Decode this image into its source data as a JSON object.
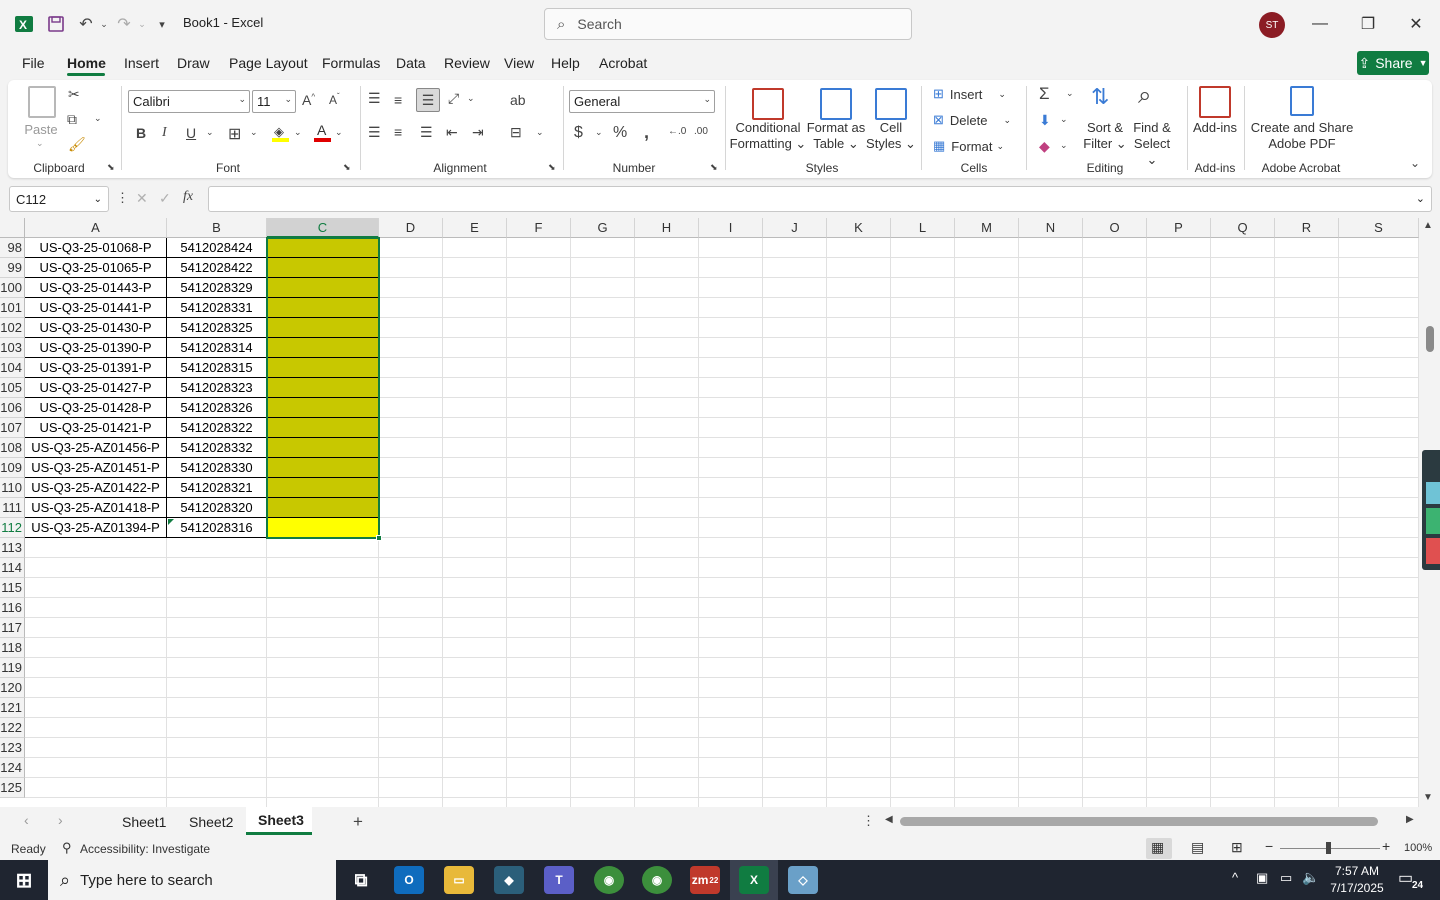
{
  "window": {
    "title": "Book1  -  Excel",
    "search_placeholder": "Search",
    "user_initials": "ST"
  },
  "menu": {
    "tabs": [
      "File",
      "Home",
      "Insert",
      "Draw",
      "Page Layout",
      "Formulas",
      "Data",
      "Review",
      "View",
      "Help",
      "Acrobat"
    ],
    "active": "Home",
    "share_label": "Share"
  },
  "ribbon": {
    "clipboard": {
      "label": "Clipboard",
      "paste": "Paste"
    },
    "font": {
      "label": "Font",
      "family": "Calibri",
      "size": "11"
    },
    "alignment": {
      "label": "Alignment"
    },
    "number": {
      "label": "Number",
      "format": "General"
    },
    "styles": {
      "label": "Styles",
      "conditional": [
        "Conditional",
        "Formatting"
      ],
      "format_table": [
        "Format as",
        "Table"
      ],
      "cell_styles": [
        "Cell",
        "Styles"
      ]
    },
    "cells": {
      "label": "Cells",
      "insert": "Insert",
      "delete": "Delete",
      "format": "Format"
    },
    "editing": {
      "label": "Editing",
      "sort": [
        "Sort &",
        "Filter"
      ],
      "find": [
        "Find &",
        "Select"
      ]
    },
    "addins": {
      "label": "Add-ins",
      "button": "Add-ins"
    },
    "acrobat": {
      "label": "Adobe Acrobat",
      "button": [
        "Create and Share",
        "Adobe PDF"
      ]
    }
  },
  "formula_bar": {
    "name_box": "C112",
    "fx": "fx",
    "value": ""
  },
  "grid": {
    "columns": [
      "A",
      "B",
      "C",
      "D",
      "E",
      "F",
      "G",
      "H",
      "I",
      "J",
      "K",
      "L",
      "M",
      "N",
      "O",
      "P",
      "Q",
      "R",
      "S"
    ],
    "selected_column": "C",
    "rows": [
      {
        "num": "98",
        "a": "US-Q3-25-01068-P",
        "b": "5412028424"
      },
      {
        "num": "99",
        "a": "US-Q3-25-01065-P",
        "b": "5412028422"
      },
      {
        "num": "100",
        "a": "US-Q3-25-01443-P",
        "b": "5412028329"
      },
      {
        "num": "101",
        "a": "US-Q3-25-01441-P",
        "b": "5412028331"
      },
      {
        "num": "102",
        "a": "US-Q3-25-01430-P",
        "b": "5412028325"
      },
      {
        "num": "103",
        "a": "US-Q3-25-01390-P",
        "b": "5412028314"
      },
      {
        "num": "104",
        "a": "US-Q3-25-01391-P",
        "b": "5412028315"
      },
      {
        "num": "105",
        "a": "US-Q3-25-01427-P",
        "b": "5412028323"
      },
      {
        "num": "106",
        "a": "US-Q3-25-01428-P",
        "b": "5412028326"
      },
      {
        "num": "107",
        "a": "US-Q3-25-01421-P",
        "b": "5412028322"
      },
      {
        "num": "108",
        "a": "US-Q3-25-AZ01456-P",
        "b": "5412028332"
      },
      {
        "num": "109",
        "a": "US-Q3-25-AZ01451-P",
        "b": "5412028330"
      },
      {
        "num": "110",
        "a": "US-Q3-25-AZ01422-P",
        "b": "5412028321"
      },
      {
        "num": "111",
        "a": "US-Q3-25-AZ01418-P",
        "b": "5412028320"
      },
      {
        "num": "112",
        "a": "US-Q3-25-AZ01394-P",
        "b": "5412028316"
      }
    ],
    "empty_rows": [
      "113",
      "114",
      "115",
      "116",
      "117",
      "118",
      "119",
      "120",
      "121",
      "122",
      "123",
      "124",
      "125"
    ],
    "fill_color": "#c8c800",
    "active_fill_color": "#ffff00"
  },
  "sheets": {
    "tabs": [
      "Sheet1",
      "Sheet2",
      "Sheet3"
    ],
    "active": "Sheet3"
  },
  "status": {
    "ready": "Ready",
    "accessibility": "Accessibility: Investigate",
    "zoom": "100%"
  },
  "taskbar": {
    "search_placeholder": "Type here to search",
    "time": "7:57 AM",
    "date": "7/17/2025",
    "notification_count": "24",
    "zoom_badge": "22"
  },
  "colors": {
    "accent": "#107c41",
    "user_avatar": "#8b1c24"
  }
}
